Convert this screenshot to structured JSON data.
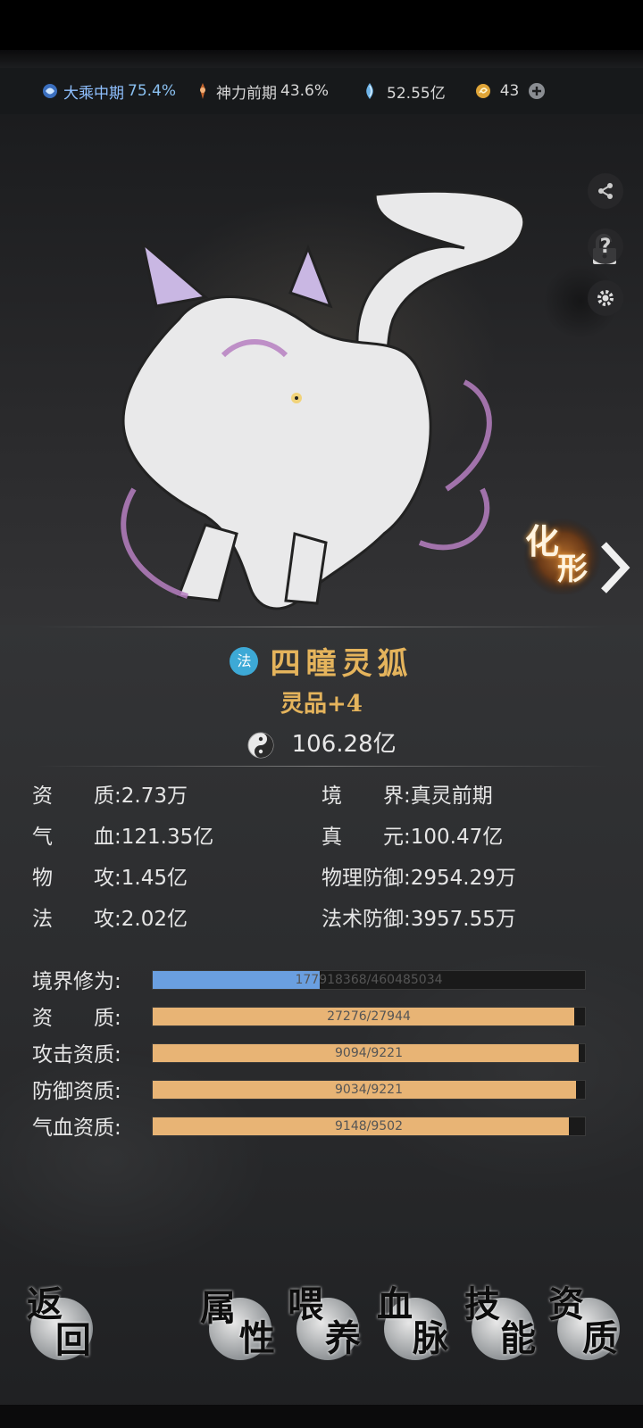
{
  "topbar": {
    "realm": {
      "label": "大乘中期",
      "value": "75.4%"
    },
    "divine": {
      "label": "神力前期",
      "value": "43.6%"
    },
    "spirit_stone": {
      "value": "52.55亿"
    },
    "currency": {
      "value": "43"
    }
  },
  "side_icons": [
    "lock-icon",
    "share-icon",
    "help-icon",
    "settings-icon"
  ],
  "huaxing_label": "化形",
  "pet": {
    "type_badge": "法",
    "name": "四瞳灵狐",
    "grade": "灵品+4",
    "power": "106.28亿"
  },
  "stats": {
    "zizhi": {
      "label": "资　　质:",
      "value": "2.73万"
    },
    "jingjie": {
      "label": "境　　界:",
      "value": "真灵前期"
    },
    "qixue": {
      "label": "气　　血:",
      "value": "121.35亿"
    },
    "zhenyuan": {
      "label": "真　　元:",
      "value": "100.47亿"
    },
    "wugong": {
      "label": "物　　攻:",
      "value": "1.45亿"
    },
    "wulifangyu": {
      "label": "物理防御:",
      "value": "2954.29万"
    },
    "fagong": {
      "label": "法　　攻:",
      "value": "2.02亿"
    },
    "fashufangyu": {
      "label": "法术防御:",
      "value": "3957.55万"
    }
  },
  "progress": [
    {
      "label": "境界修为:",
      "text": "177918368/460485034",
      "fraction": 0.386,
      "color": "#6a9fe0"
    },
    {
      "label": "资　　质:",
      "text": "27276/27944",
      "fraction": 0.976,
      "color": "#e8b475"
    },
    {
      "label": "攻击资质:",
      "text": "9094/9221",
      "fraction": 0.986,
      "color": "#e8b475"
    },
    {
      "label": "防御资质:",
      "text": "9034/9221",
      "fraction": 0.98,
      "color": "#e8b475"
    },
    {
      "label": "气血资质:",
      "text": "9148/9502",
      "fraction": 0.963,
      "color": "#e8b475"
    }
  ],
  "nav": {
    "back": [
      "返",
      "回"
    ],
    "attr": [
      "属",
      "性"
    ],
    "feed": [
      "喂",
      "养"
    ],
    "blood": [
      "血",
      "脉"
    ],
    "skill": [
      "技",
      "能"
    ],
    "qual": [
      "资",
      "质"
    ]
  }
}
